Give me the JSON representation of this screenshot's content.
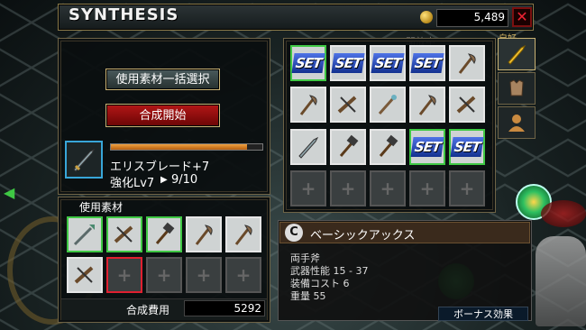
{
  "header": {
    "title": "SYNTHESIS",
    "gold": "5,489",
    "close_label": "✕"
  },
  "side_tab_label": "自好",
  "behind_text": "開放中",
  "synthesis": {
    "select_all_button": "使用素材一括選択",
    "start_button": "合成開始",
    "item_name": "エリスブレード+7",
    "level_label": "強化Lv7",
    "level_arrow": "▶",
    "level_progress": "9/10",
    "progress_fraction": 0.9
  },
  "materials": {
    "label": "使用素材",
    "cost_label": "合成費用",
    "cost_value": "5292",
    "slots": [
      {
        "state": "item",
        "icon": "spear-icon",
        "border": "green"
      },
      {
        "state": "item",
        "icon": "crossbow-icon",
        "border": "green"
      },
      {
        "state": "item",
        "icon": "hammer-icon",
        "border": "green"
      },
      {
        "state": "item",
        "icon": "axe-icon",
        "border": "white"
      },
      {
        "state": "item",
        "icon": "axe-icon",
        "border": "white"
      },
      {
        "state": "item",
        "icon": "crossbow-icon",
        "border": "white"
      },
      {
        "state": "empty",
        "border": "red"
      },
      {
        "state": "empty",
        "border": "none"
      },
      {
        "state": "empty",
        "border": "none"
      },
      {
        "state": "empty",
        "border": "none"
      }
    ]
  },
  "inventory": {
    "set_label": "SET",
    "slots": [
      {
        "state": "set",
        "border": "green"
      },
      {
        "state": "set",
        "border": "white"
      },
      {
        "state": "set",
        "border": "white"
      },
      {
        "state": "set",
        "border": "white"
      },
      {
        "state": "item",
        "icon": "axe-icon",
        "border": "white"
      },
      {
        "state": "item",
        "icon": "axe-icon",
        "border": "white"
      },
      {
        "state": "item",
        "icon": "crossbow-icon",
        "border": "white"
      },
      {
        "state": "item",
        "icon": "staff-icon",
        "border": "white"
      },
      {
        "state": "item",
        "icon": "axe-icon",
        "border": "white"
      },
      {
        "state": "item",
        "icon": "crossbow-icon",
        "border": "white"
      },
      {
        "state": "item",
        "icon": "sword-icon",
        "border": "white"
      },
      {
        "state": "item",
        "icon": "hammer-icon",
        "border": "white"
      },
      {
        "state": "item",
        "icon": "hammer-icon",
        "border": "white"
      },
      {
        "state": "set",
        "border": "green"
      },
      {
        "state": "set",
        "border": "green"
      },
      {
        "state": "empty"
      },
      {
        "state": "empty"
      },
      {
        "state": "empty"
      },
      {
        "state": "empty"
      },
      {
        "state": "empty"
      }
    ]
  },
  "tabs": [
    {
      "icon": "sword-icon",
      "active": true
    },
    {
      "icon": "armor-icon",
      "active": false
    },
    {
      "icon": "character-icon",
      "active": false
    }
  ],
  "info": {
    "badge": "C",
    "name": "ベーシックアックス",
    "lines": [
      "両手斧",
      "武器性能 15 - 37",
      "装備コスト 6",
      "重量 55"
    ],
    "bonus_button": "ボーナス効果"
  },
  "colors": {
    "accent_gold": "#c9b274",
    "start_red": "#b41717",
    "set_blue": "#2a4fc4",
    "select_cyan": "#38a6d8"
  }
}
